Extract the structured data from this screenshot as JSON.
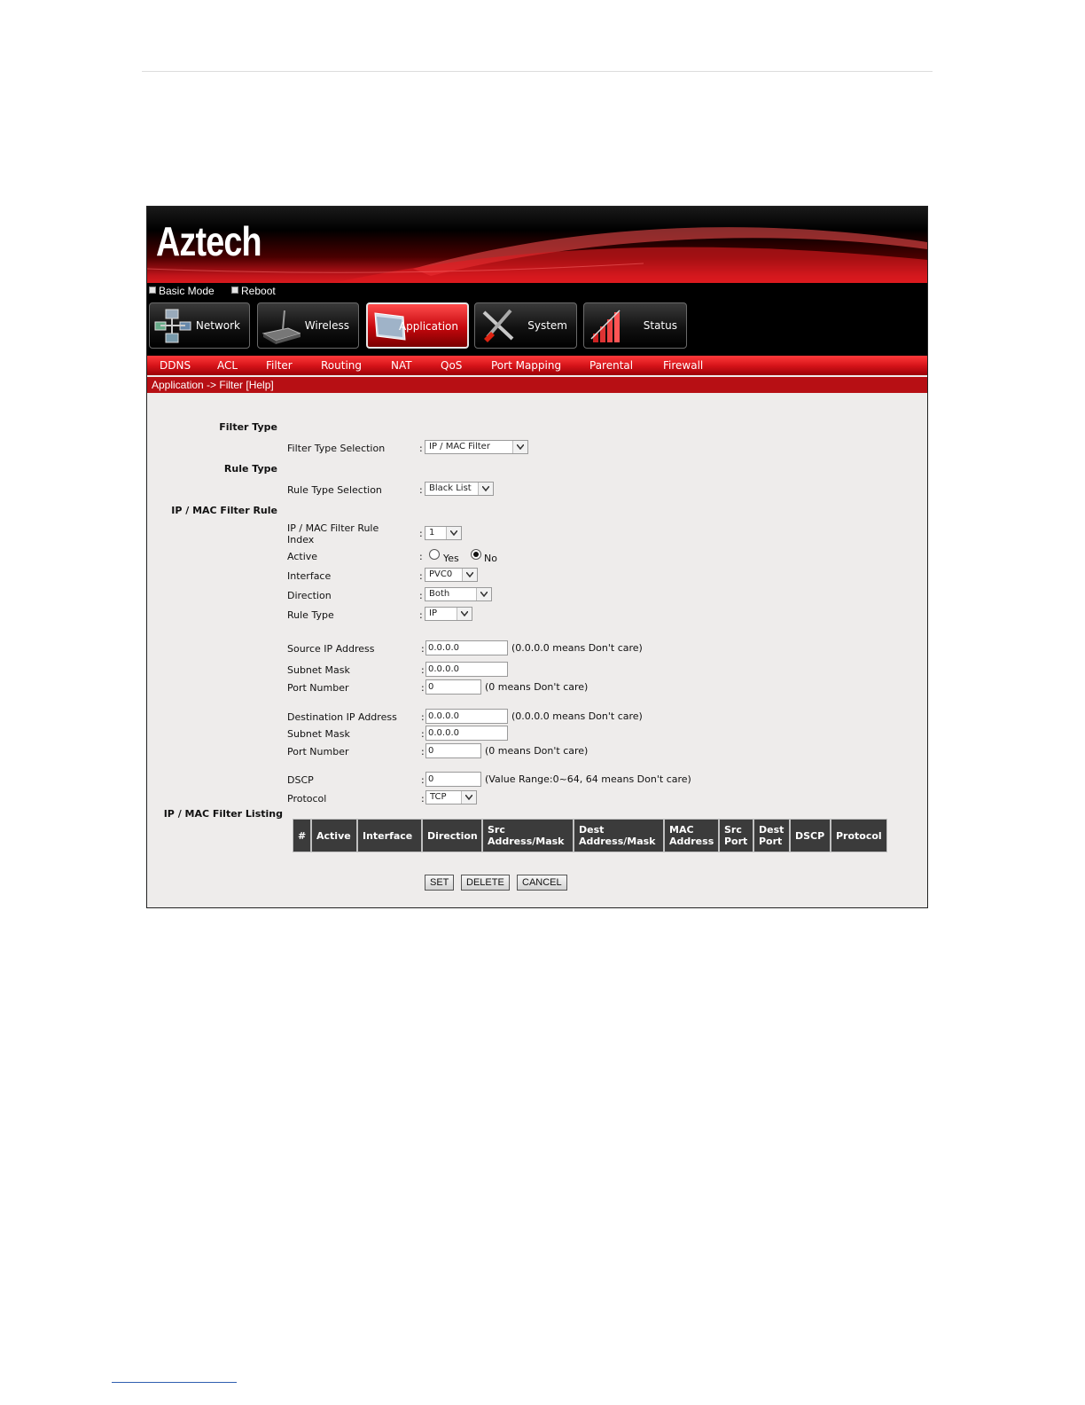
{
  "brand": {
    "logo": "Aztech"
  },
  "quick_links": {
    "basic_mode": "Basic Mode",
    "reboot": "Reboot"
  },
  "main_tabs": [
    {
      "label": "Network",
      "icon": "network-icon",
      "active": false
    },
    {
      "label": "Wireless",
      "icon": "router-icon",
      "active": false
    },
    {
      "label": "Application",
      "icon": "application-icon",
      "active": true
    },
    {
      "label": "System",
      "icon": "tools-icon",
      "active": false
    },
    {
      "label": "Status",
      "icon": "chart-icon",
      "active": false
    }
  ],
  "sub_tabs": [
    "DDNS",
    "ACL",
    "Filter",
    "Routing",
    "NAT",
    "QoS",
    "Port Mapping",
    "Parental",
    "Firewall"
  ],
  "breadcrumb": "Application -> Filter [Help]",
  "form": {
    "filter_type": {
      "heading": "Filter Type",
      "selection_label": "Filter Type Selection",
      "selection_value": "IP / MAC Filter"
    },
    "rule_type": {
      "heading": "Rule Type",
      "selection_label": "Rule Type Selection",
      "selection_value": "Black List"
    },
    "rule": {
      "heading": "IP / MAC Filter Rule",
      "index_label_line1": "IP / MAC Filter Rule",
      "index_label_line2": "Index",
      "index_value": "1",
      "active_label": "Active",
      "active_options": [
        "Yes",
        "No"
      ],
      "active_selected": "No",
      "interface_label": "Interface",
      "interface_value": "PVC0",
      "direction_label": "Direction",
      "direction_value": "Both",
      "rule_type_label": "Rule Type",
      "rule_type_value": "IP",
      "source_ip_label": "Source IP Address",
      "source_ip_value": "0.0.0.0",
      "source_ip_hint": "(0.0.0.0 means Don't care)",
      "source_mask_label": "Subnet Mask",
      "source_mask_value": "0.0.0.0",
      "source_port_label": "Port Number",
      "source_port_value": "0",
      "source_port_hint": "(0 means Don't care)",
      "dest_ip_label": "Destination IP Address",
      "dest_ip_value": "0.0.0.0",
      "dest_ip_hint": "(0.0.0.0 means Don't care)",
      "dest_mask_label": "Subnet Mask",
      "dest_mask_value": "0.0.0.0",
      "dest_port_label": "Port Number",
      "dest_port_value": "0",
      "dest_port_hint": "(0 means Don't care)",
      "dscp_label": "DSCP",
      "dscp_value": "0",
      "dscp_hint": "(Value Range:0~64, 64 means Don't care)",
      "protocol_label": "Protocol",
      "protocol_value": "TCP"
    },
    "listing": {
      "heading": "IP / MAC Filter Listing",
      "columns": [
        [
          "#"
        ],
        [
          "Active"
        ],
        [
          "Interface"
        ],
        [
          "Direction"
        ],
        [
          "Src",
          "Address/Mask"
        ],
        [
          "Dest",
          "Address/Mask"
        ],
        [
          "MAC",
          "Address"
        ],
        [
          "Src",
          "Port"
        ],
        [
          "Dest",
          "Port"
        ],
        [
          "DSCP"
        ],
        [
          "Protocol"
        ]
      ]
    },
    "buttons": {
      "set": "SET",
      "delete": "DELETE",
      "cancel": "CANCEL"
    }
  },
  "colors": {
    "brand_red": "#d7141a",
    "banner_black": "#000000",
    "content_bg": "#eeeceb",
    "header_cell": "#3b3b3b"
  }
}
